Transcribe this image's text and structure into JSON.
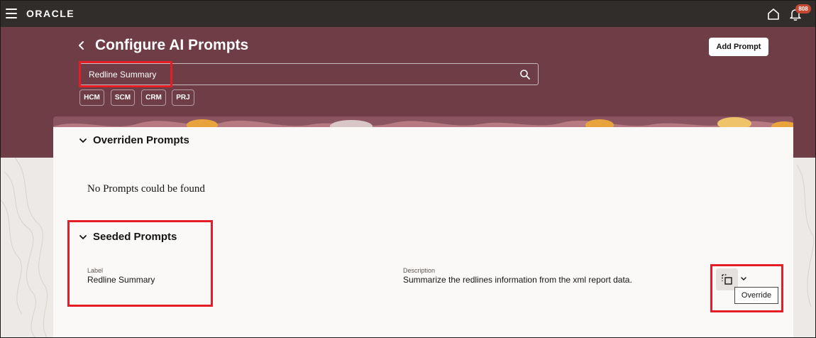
{
  "header": {
    "logo_text": "ORACLE",
    "notification_count": "808"
  },
  "page": {
    "title": "Configure AI Prompts",
    "add_prompt_label": "Add Prompt"
  },
  "search": {
    "value": "Redline Summary"
  },
  "filters": [
    "HCM",
    "SCM",
    "CRM",
    "PRJ"
  ],
  "overridden": {
    "title": "Overriden Prompts",
    "empty_message": "No Prompts could be found"
  },
  "seeded": {
    "title": "Seeded Prompts",
    "label_caption": "Label",
    "label_value": "Redline Summary",
    "description_caption": "Description",
    "description_value": "Summarize the redlines information from the xml report data.",
    "action_tooltip": "Override"
  },
  "colors": {
    "header_bg": "#312d2a",
    "hero_bg": "#6e3d46",
    "highlight": "#e41e26",
    "badge": "#c74634"
  },
  "icons": [
    "menu-icon",
    "home-icon",
    "bell-icon",
    "back-icon",
    "search-icon",
    "chevron-down-icon",
    "override-icon"
  ]
}
